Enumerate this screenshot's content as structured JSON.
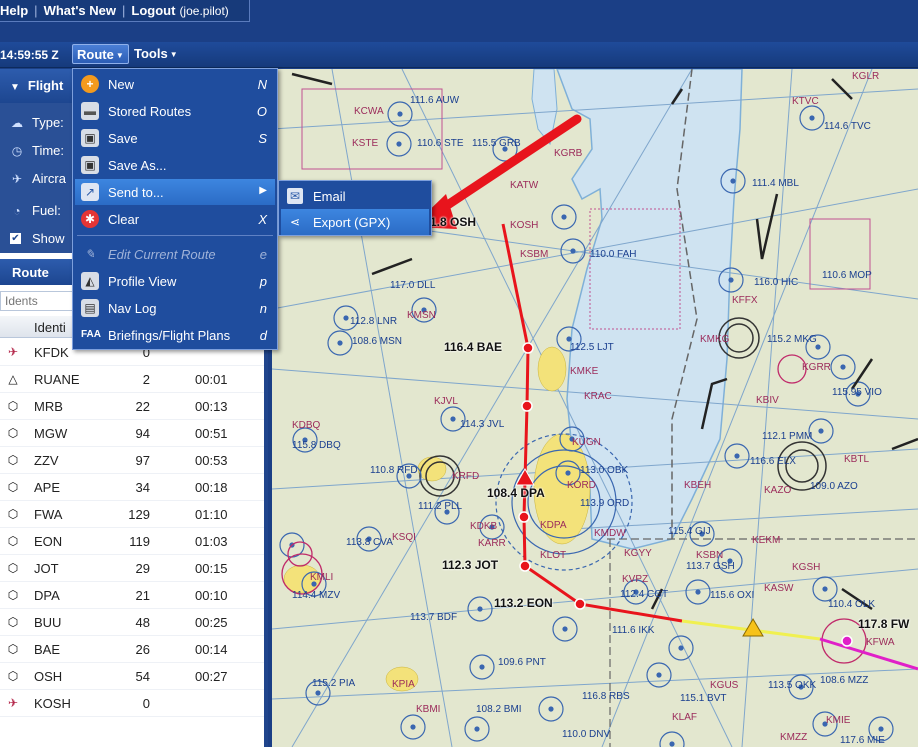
{
  "topnav": {
    "help": "Help",
    "whats_new": "What's New",
    "logout": "Logout",
    "user": "(joe.pilot)"
  },
  "toolbar": {
    "clock": "14:59:55 Z",
    "route_menu": "Route",
    "tools_menu": "Tools"
  },
  "left_panel": {
    "flight_header": "Flight",
    "options": [
      {
        "label": "Type:",
        "icon": "cloud-icon"
      },
      {
        "label": "Time:",
        "icon": "clock-icon"
      },
      {
        "label": "Aircra",
        "icon": "airplane-icon"
      },
      {
        "label": "Fuel:",
        "icon": "gauge-icon"
      },
      {
        "label": "Show",
        "icon": "checkbox-icon"
      }
    ],
    "route_header": "Route",
    "ident_placeholder": "Idents",
    "column_ident": "Identi",
    "waypoints": [
      {
        "ident": "KFDK",
        "dist": "0",
        "time": "",
        "kind": "airport"
      },
      {
        "ident": "RUANE",
        "dist": "2",
        "time": "00:01",
        "kind": "fix"
      },
      {
        "ident": "MRB",
        "dist": "22",
        "time": "00:13",
        "kind": "vor"
      },
      {
        "ident": "MGW",
        "dist": "94",
        "time": "00:51",
        "kind": "vor"
      },
      {
        "ident": "ZZV",
        "dist": "97",
        "time": "00:53",
        "kind": "vor"
      },
      {
        "ident": "APE",
        "dist": "34",
        "time": "00:18",
        "kind": "vor"
      },
      {
        "ident": "FWA",
        "dist": "129",
        "time": "01:10",
        "kind": "vor"
      },
      {
        "ident": "EON",
        "dist": "119",
        "time": "01:03",
        "kind": "vor"
      },
      {
        "ident": "JOT",
        "dist": "29",
        "time": "00:15",
        "kind": "vor"
      },
      {
        "ident": "DPA",
        "dist": "21",
        "time": "00:10",
        "kind": "vor"
      },
      {
        "ident": "BUU",
        "dist": "48",
        "time": "00:25",
        "kind": "vor"
      },
      {
        "ident": "BAE",
        "dist": "26",
        "time": "00:14",
        "kind": "vor"
      },
      {
        "ident": "OSH",
        "dist": "54",
        "time": "00:27",
        "kind": "vor"
      },
      {
        "ident": "KOSH",
        "dist": "0",
        "time": "",
        "kind": "airport"
      }
    ]
  },
  "route_menu": {
    "items": [
      {
        "label": "New",
        "key": "N",
        "icon": "plus-circle-icon"
      },
      {
        "label": "Stored Routes",
        "key": "O",
        "icon": "folder-icon"
      },
      {
        "label": "Save",
        "key": "S",
        "icon": "floppy-icon"
      },
      {
        "label": "Save As...",
        "key": "",
        "icon": "floppy-icon"
      },
      {
        "label": "Send to...",
        "key": "",
        "icon": "share-icon"
      },
      {
        "label": "Clear",
        "key": "X",
        "icon": "clear-icon"
      },
      {
        "label": "Edit Current Route",
        "key": "e",
        "icon": "pencil-icon"
      },
      {
        "label": "Profile View",
        "key": "p",
        "icon": "profile-icon"
      },
      {
        "label": "Nav Log",
        "key": "n",
        "icon": "navlog-icon"
      },
      {
        "label": "Briefings/Flight Plans",
        "key": "d",
        "icon": "faa-icon"
      }
    ],
    "faa_badge": "FAA"
  },
  "send_submenu": {
    "items": [
      {
        "label": "Email",
        "icon": "email-icon"
      },
      {
        "label": "Export (GPX)",
        "icon": "share-nodes-icon"
      }
    ]
  },
  "map": {
    "route_labels": [
      {
        "text": "1.8 OSH"
      },
      {
        "text": "116.4 BAE"
      },
      {
        "text": "108.4 DPA"
      },
      {
        "text": "112.3 JOT"
      },
      {
        "text": "113.2 EON"
      },
      {
        "text": "117.8 FW"
      }
    ],
    "chart_labels": [
      "KGLR",
      "111.6 AUW",
      "KCWA",
      "KSTE",
      "110.6 STE",
      "115.5 GRB",
      "KGRB",
      "KTVC",
      "114.6 TVC",
      "KATW",
      "KOSH",
      "111.4 MBL",
      "KSBM",
      "110.0 FAH",
      "117.0 DLL",
      "116.0 HIC",
      "110.6 MOP",
      "KFFX",
      "112.8 LNR",
      "KMSN",
      "108.6 MSN",
      "KMKG",
      "115.2 MKG",
      "112.5 LJT",
      "KMKE",
      "KGRR",
      "KRAC",
      "KBIV",
      "115.95 VIO",
      "KJVL",
      "114.3 JVL",
      "KDBQ",
      "115.8 DBQ",
      "KUGN",
      "112.1 PMM",
      "KBTL",
      "113.0 OBK",
      "110.8 RFD",
      "KRFD",
      "KORD",
      "113.9 ORD",
      "116.6 ELX",
      "KBEH",
      "KAZO",
      "109.0 AZO",
      "111.2 PLL",
      "KDKB",
      "KDPA",
      "KMDW",
      "115.4 GIJ",
      "KEKM",
      "113.8 CVA",
      "KSQI",
      "KARR",
      "KLOT",
      "KGYY",
      "KSBN",
      "113.7 GSH",
      "KGSH",
      "KMLI",
      "114.4 MZV",
      "KVPZ",
      "112.4 CGT",
      "115.6 OXI",
      "KASW",
      "110.4 OLK",
      "113.7 BDF",
      "111.6 IKK",
      "KFWA",
      "109.6 PNT",
      "115.2 PIA",
      "KPIA",
      "116.8 RBS",
      "KGUS",
      "113.5 OKK",
      "115.1 BVT",
      "108.6 MZZ",
      "KBMI",
      "108.2 BMI",
      "KLAF",
      "KMIE",
      "110.0 DNV",
      "KMZZ",
      "117.6 MIE"
    ]
  }
}
